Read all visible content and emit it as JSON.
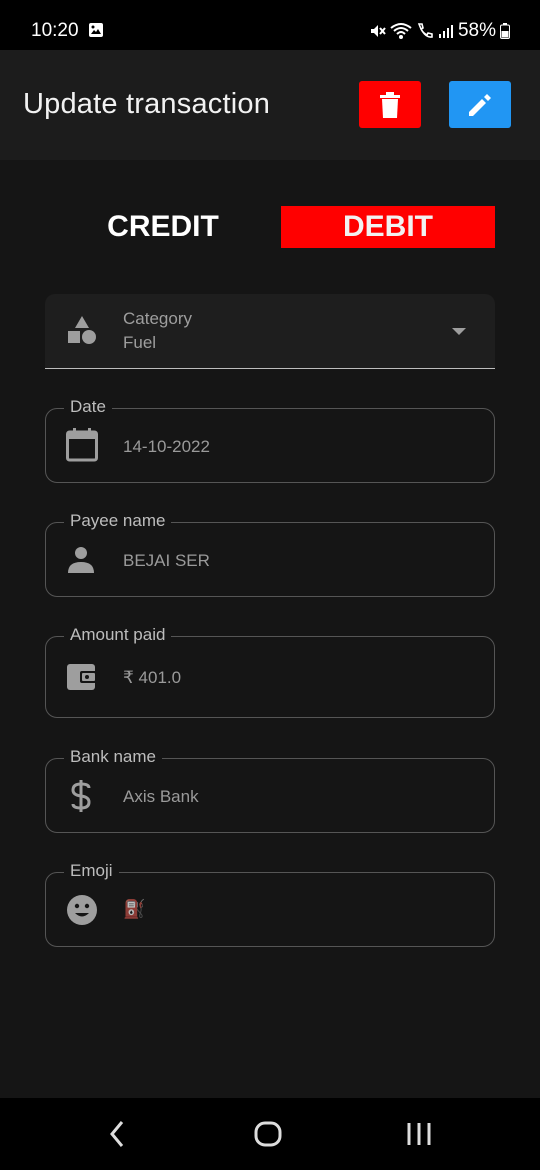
{
  "status_bar": {
    "time": "10:20",
    "battery": "58%"
  },
  "app_bar": {
    "title": "Update transaction",
    "delete_icon": "trash-icon",
    "edit_icon": "pencil-icon"
  },
  "toggle": {
    "credit_label": "CREDIT",
    "debit_label": "DEBIT",
    "selected": "DEBIT"
  },
  "category": {
    "label": "Category",
    "value": "Fuel",
    "icon": "shapes-icon"
  },
  "fields": {
    "date": {
      "label": "Date",
      "value": "14-10-2022",
      "icon": "calendar-icon"
    },
    "payee": {
      "label": "Payee name",
      "value": "BEJAI SER",
      "icon": "person-icon"
    },
    "amount": {
      "label": "Amount paid",
      "value": "₹ 401.0",
      "icon": "wallet-icon"
    },
    "bank": {
      "label": "Bank name",
      "value": "Axis Bank",
      "icon": "dollar-icon"
    },
    "emoji": {
      "label": "Emoji",
      "value": "⛽",
      "icon": "smiley-icon"
    }
  },
  "colors": {
    "debit": "#ff0000",
    "edit": "#2196f3",
    "background": "#151515"
  }
}
